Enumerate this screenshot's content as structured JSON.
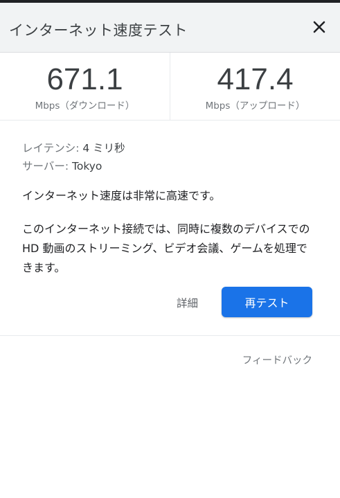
{
  "header": {
    "title": "インターネット速度テスト",
    "close_icon": "close-icon"
  },
  "speeds": {
    "download": {
      "value": "671.1",
      "unit": "Mbps（ダウンロード）"
    },
    "upload": {
      "value": "417.4",
      "unit": "Mbps（アップロード）"
    }
  },
  "details": {
    "latency_label": "レイテンシ:",
    "latency_value": "4 ミリ秒",
    "server_label": "サーバー:",
    "server_value": "Tokyo",
    "status": "インターネット速度は非常に高速です。",
    "description": "このインターネット接続では、同時に複数のデバイスでの HD 動画のストリーミング、ビデオ会議、ゲームを処理できます。"
  },
  "actions": {
    "details_label": "詳細",
    "retest_label": "再テスト"
  },
  "footer": {
    "feedback_label": "フィードバック"
  },
  "colors": {
    "accent": "#1a73e8",
    "header_bg": "#f1f3f4"
  }
}
